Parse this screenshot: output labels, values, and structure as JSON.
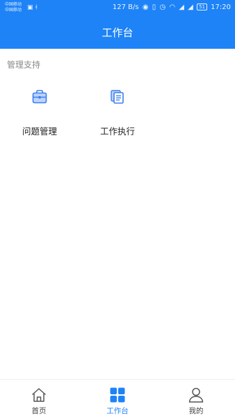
{
  "status_bar": {
    "carrier_1": "中国移动",
    "carrier_2": "中国移动",
    "network_speed": "127 B/s",
    "battery": "51",
    "time": "17:20"
  },
  "header": {
    "title": "工作台"
  },
  "section": {
    "label": "管理支持",
    "items": [
      {
        "label": "问题管理",
        "icon": "briefcase-icon"
      },
      {
        "label": "工作执行",
        "icon": "document-icon"
      }
    ]
  },
  "tabbar": {
    "tabs": [
      {
        "label": "首页",
        "icon": "home-icon",
        "active": false
      },
      {
        "label": "工作台",
        "icon": "grid-icon",
        "active": true
      },
      {
        "label": "我的",
        "icon": "user-icon",
        "active": false
      }
    ]
  },
  "colors": {
    "primary": "#1e83f7",
    "icon_blue": "#3c7ff0",
    "icon_light": "#bcd3fb"
  }
}
